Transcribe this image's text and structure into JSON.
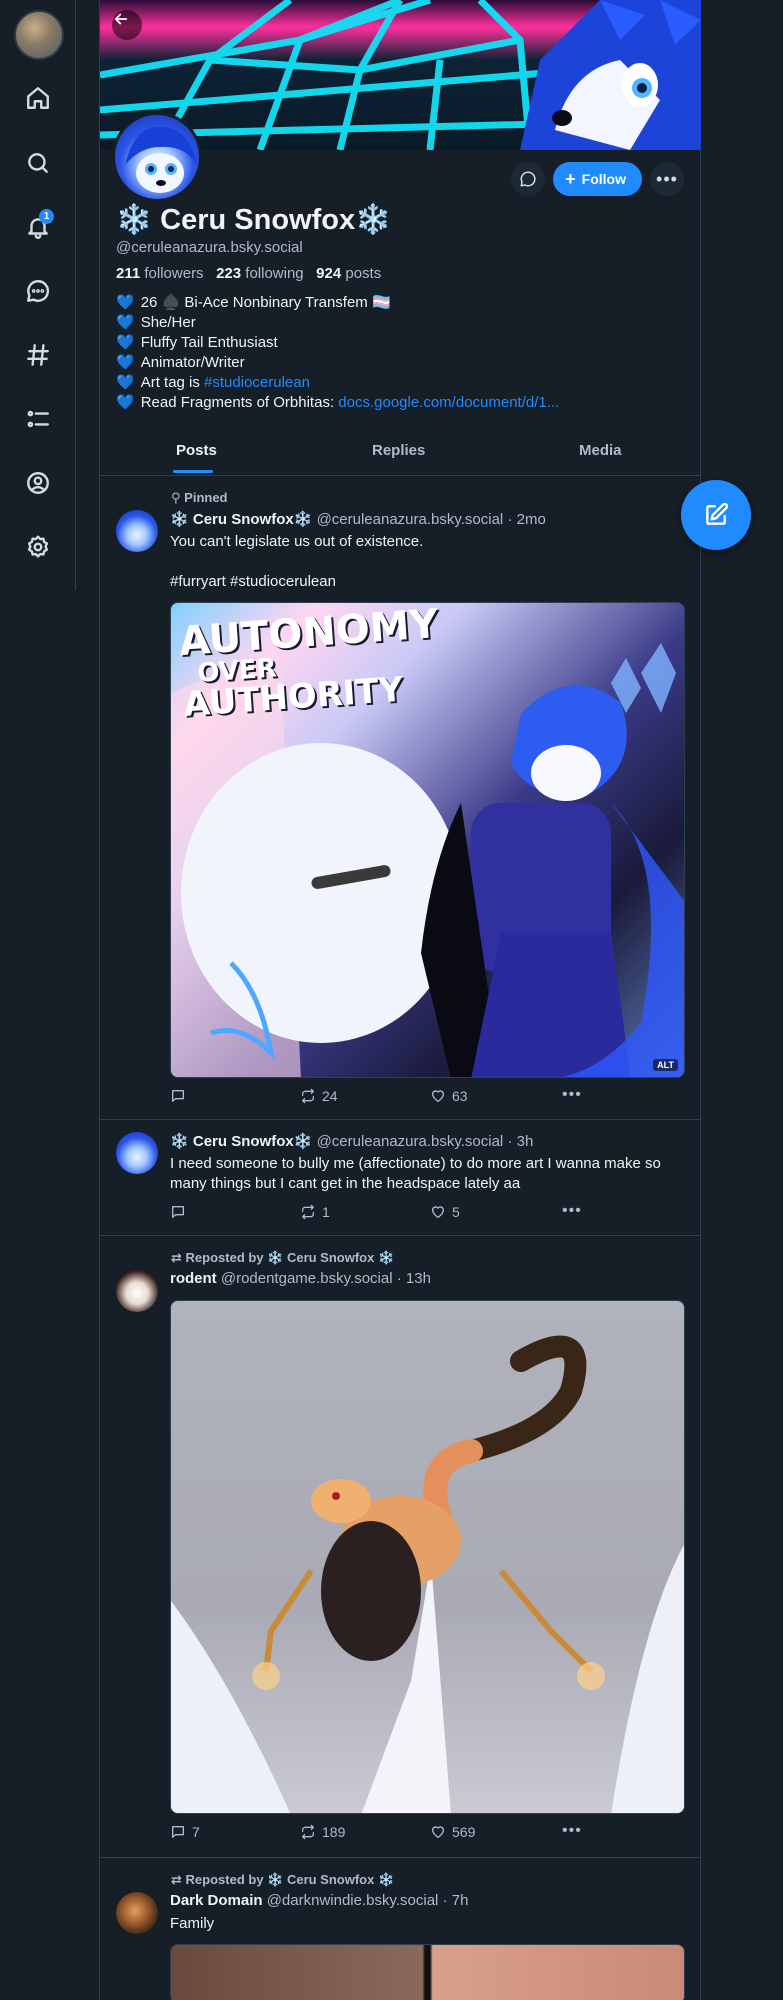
{
  "nav": {
    "items": [
      {
        "icon": "home-icon"
      },
      {
        "icon": "search-icon"
      },
      {
        "icon": "bell-icon",
        "badge": "1"
      },
      {
        "icon": "chat-icon"
      },
      {
        "icon": "hashtag-icon"
      },
      {
        "icon": "list-icon"
      },
      {
        "icon": "profile-icon"
      },
      {
        "icon": "settings-icon"
      }
    ]
  },
  "profile": {
    "flake": "❄️",
    "display_name": "Ceru Snowfox",
    "handle": "@ceruleanazura.bsky.social",
    "followers_count": "211",
    "followers_label": "followers",
    "following_count": "223",
    "following_label": "following",
    "posts_count": "924",
    "posts_label": "posts",
    "follow_label": "Follow",
    "bio": [
      {
        "heart": "💙",
        "text": "26 ♠️ Bi-Ace Nonbinary Transfem 🏳️‍⚧️",
        "link": ""
      },
      {
        "heart": "💙",
        "text": "She/Her",
        "link": ""
      },
      {
        "heart": "💙",
        "text": "Fluffy Tail Enthusiast",
        "link": ""
      },
      {
        "heart": "💙",
        "text": "Animator/Writer",
        "link": ""
      },
      {
        "heart": "💙",
        "text": "Art tag is ",
        "link": "#studiocerulean"
      },
      {
        "heart": "💙",
        "text": "Read Fragments of Orbhitas: ",
        "link": "docs.google.com/document/d/1..."
      }
    ]
  },
  "tabs": [
    "Posts",
    "Replies",
    "Media"
  ],
  "posts": [
    {
      "context": "Pinned",
      "author": "Ceru Snowfox",
      "flake": "❄️",
      "handle": "@ceruleanazura.bsky.social",
      "time": "· 2mo",
      "text": "You can't legislate us out of existence.",
      "tags": "#furryart #studiocerulean",
      "image_title_1": "AUTONOMY",
      "image_title_2": "OVER",
      "image_title_3": "AUTHORITY",
      "alt": "ALT",
      "replies": "",
      "reposts": "24",
      "likes": "63"
    },
    {
      "context": "",
      "author": "Ceru Snowfox",
      "flake": "❄️",
      "handle": "@ceruleanazura.bsky.social",
      "time": "· 3h",
      "text": "I need someone to bully me (affectionate) to do more art I wanna make so many things but I cant get in the headspace lately aa",
      "replies": "",
      "reposts": "1",
      "likes": "5"
    },
    {
      "context": "Reposted by ❄️ Ceru Snowfox ❄️",
      "author": "rodent",
      "handle": "@rodentgame.bsky.social",
      "time": "· 13h",
      "replies": "7",
      "reposts": "189",
      "likes": "569"
    },
    {
      "context": "Reposted by ❄️ Ceru Snowfox ❄️",
      "author": "Dark Domain",
      "handle": "@darknwindie.bsky.social",
      "time": "· 7h",
      "text": "Family"
    }
  ],
  "colors": {
    "accent": "#208bfe",
    "bg": "#161e27",
    "border": "#2e4052",
    "muted": "#aebbc9"
  }
}
